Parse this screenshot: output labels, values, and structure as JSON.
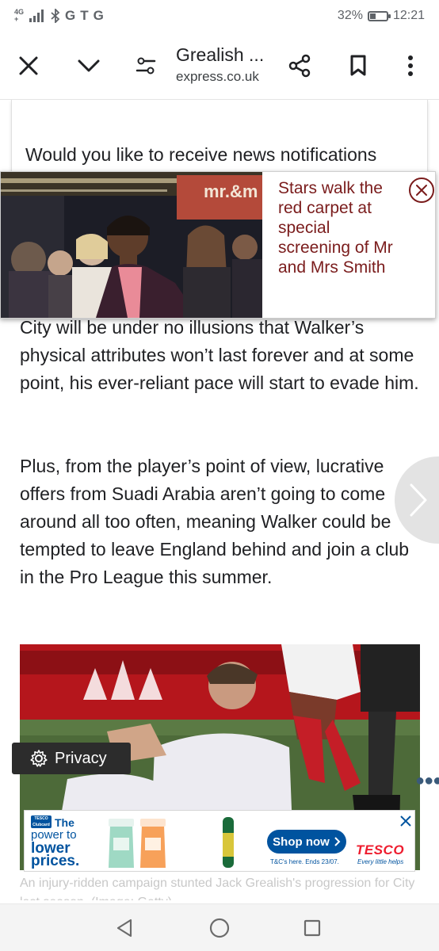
{
  "status_bar": {
    "network_top": "4G",
    "network_bottom": "+",
    "app_letters": [
      "G",
      "T",
      "G"
    ],
    "battery_text": "32%",
    "battery_level": 0.32,
    "time": "12:21"
  },
  "toolbar": {
    "title": "Grealish ...",
    "domain": "express.co.uk"
  },
  "notification_card": {
    "text": "Would you like to receive news notifications"
  },
  "video_banner": {
    "caption": "Stars walk the red carpet at special screening of Mr and Mrs Smith",
    "sign_text": "mr.&m"
  },
  "article": {
    "paragraph_1": "City will be under no illusions that Walker’s physical attributes won’t last forever and at some point, his ever-reliant pace will start to evade him.",
    "paragraph_2": "Plus, from the player’s point of view, lucrative offers from Suadi Arabia aren’t going to come around all too often, meaning Walker could be tempted to leave England behind and join a club in the Pro League this summer.",
    "photo_caption": "An injury-ridden campaign stunted Jack Grealish's progression for City last season. (Image: Getty)"
  },
  "privacy_button": {
    "label": "Privacy"
  },
  "ad": {
    "clubcard": "TESCO Clubcard",
    "line_1": "The",
    "line_2": "power to",
    "line_3": "lower",
    "line_4": "prices.",
    "cta": "Shop now",
    "terms": "T&C's here. Ends 23/07.",
    "brand": "TESCO",
    "brand_tagline": "Every little helps",
    "brand_color": "#00539f",
    "brand_red": "#ee1c2e"
  },
  "colors": {
    "caption_red": "#7a1c1c",
    "text": "#202124"
  }
}
